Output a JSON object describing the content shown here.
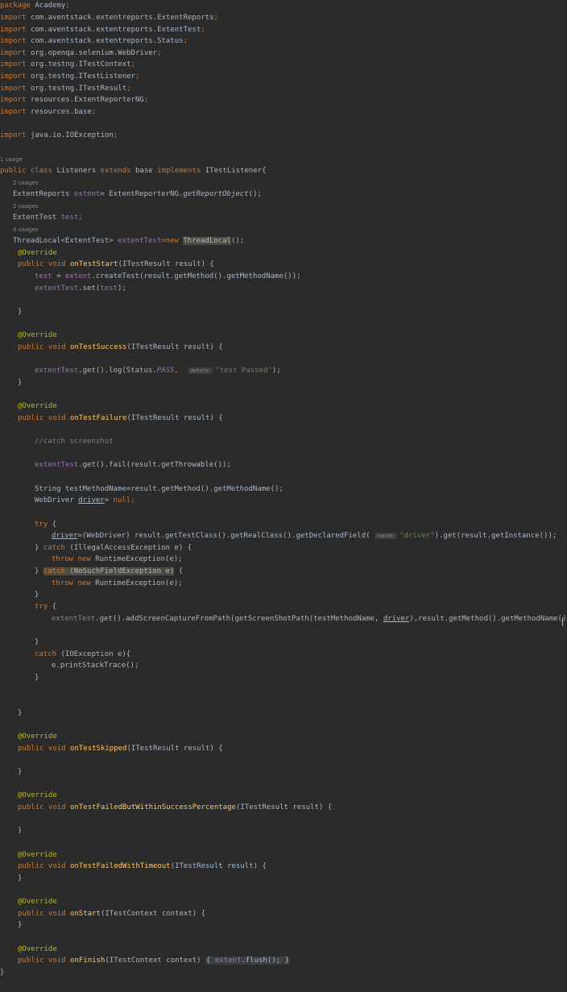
{
  "editor": {
    "package_kw": "package",
    "package_name": "Academy",
    "imports_kw": "import",
    "imports": [
      "com.aventstack.extentreports.ExtentReports",
      "com.aventstack.extentreports.ExtentTest",
      "com.aventstack.extentreports.Status",
      "org.openqa.selenium.WebDriver",
      "org.testng.ITestContext",
      "org.testng.ITestListener",
      "org.testng.ITestResult",
      "resources.ExtentReporterNG",
      "resources.base",
      "java.io.IOException"
    ],
    "usage_hints": [
      "1 usage",
      "2 usages",
      "2 usages",
      "4 usages"
    ],
    "class_decl": {
      "public_class": "public class",
      "name": "Listeners",
      "extends_kw": "extends",
      "base": "base",
      "implements_kw": "implements",
      "iface": "ITestListener{"
    },
    "fields": {
      "reports_type": "ExtentReports",
      "reports_var": "extent",
      "reports_init": "= ExtentReporterNG.",
      "reports_call": "getReportObject",
      "reports_end": "();",
      "test_type": "ExtentTest",
      "test_var": "test",
      "tl_type": "ThreadLocal<ExtentTest>",
      "tl_var": "extentTest",
      "tl_new": "=new",
      "tl_class": "ThreadLocal",
      "tl_end": "();"
    },
    "override": "@Override",
    "public_void": "public void",
    "methods": {
      "start": {
        "name": "onTestStart",
        "params": "(ITestResult result) {"
      },
      "success": {
        "name": "onTestSuccess",
        "params": "(ITestResult result) {"
      },
      "failure": {
        "name": "onTestFailure",
        "params": "(ITestResult result) {"
      },
      "skipped": {
        "name": "onTestSkipped",
        "params": "(ITestResult result) {"
      },
      "pct": {
        "name": "onTestFailedButWithinSuccessPercentage",
        "params": "(ITestResult result) {"
      },
      "timeout": {
        "name": "onTestFailedWithTimeout",
        "params": "(ITestResult result) {"
      },
      "onstart": {
        "name": "onStart",
        "params": "(ITestContext context) {"
      },
      "onfinish": {
        "name": "onFinish",
        "params": "(ITestContext context)"
      }
    },
    "code": {
      "start_l1_a": "test",
      "start_l1_b": " = ",
      "start_l1_c": "extent",
      "start_l1_d": ".createTest(result.getMethod().getMethodName());",
      "start_l2_a": "extentTest",
      "start_l2_b": ".set(",
      "start_l2_c": "test",
      "start_l2_d": ");",
      "success_a": "extentTest",
      "success_b": ".get().log(Status.",
      "success_c": "PASS",
      "success_d": ",",
      "success_hint": "details:",
      "success_str": "\"test Passed\"",
      "success_e": ");",
      "comment": "//catch screenshot",
      "fail_a": "extentTest",
      "fail_b": ".get().fail(result.getThrowable());",
      "tmn": "String testMethodName=result.getMethod().getMethodName();",
      "wd_a": "WebDriver ",
      "wd_b": "driver",
      "wd_c": "= ",
      "wd_d": "null",
      "wd_e": ";",
      "try": "try",
      "brace_open": " {",
      "drv_a": "driver",
      "drv_b": "=(WebDriver) result.getTestClass().getRealClass().getDeclaredField(",
      "drv_hint": "name:",
      "drv_str": "\"driver\"",
      "drv_c": ").get(result.getInstance());",
      "close_catch": "} ",
      "catch_kw": "catch",
      "iae": " (IllegalAccessException e) {",
      "throw_new": "throw new",
      "rte": " RuntimeException(e);",
      "nsfe": " (NoSuchFieldException e)",
      "nsfe_tail": " {",
      "close_brace": "}",
      "shot_a": "extentTest",
      "shot_b": ".get().addScreenCaptureFromPath(getScreenShotPath(testMethodName, ",
      "shot_c": "driver",
      "shot_d": "),result.getMethod().getMethodName());",
      "ioe": " (IOException e){",
      "pst": "e.printStackTrace();",
      "finish_open": "{",
      "finish_var": "extent",
      "finish_call": ".flush(); ",
      "finish_close": "}",
      "semicolon": ";"
    }
  }
}
